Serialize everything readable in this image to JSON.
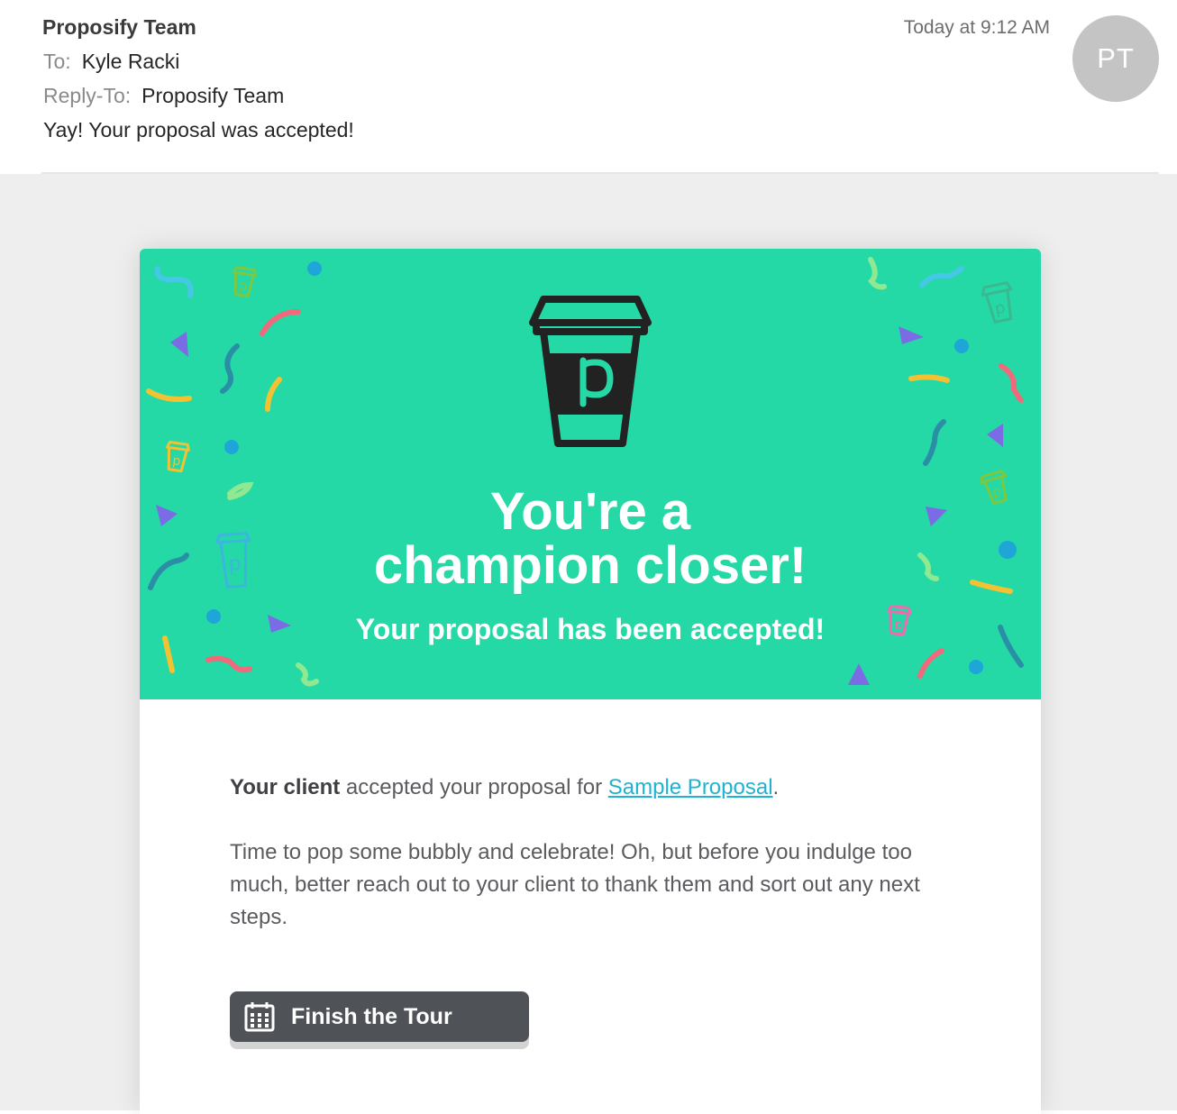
{
  "header": {
    "from": "Proposify Team",
    "to_label": "To:",
    "to_value": "Kyle Racki",
    "reply_to_label": "Reply-To:",
    "reply_to_value": "Proposify Team",
    "subject": "Yay! Your proposal was accepted!",
    "date": "Today at 9:12 AM",
    "avatar_initials": "PT"
  },
  "hero": {
    "headline_line1": "You're a",
    "headline_line2": "champion closer!",
    "subheadline": "Your proposal has been accepted!",
    "logo_letter": "p",
    "background_color": "#24d9a6"
  },
  "body": {
    "client_bold": "Your client",
    "accepted_text": " accepted your proposal for ",
    "proposal_link": "Sample Proposal",
    "period": ".",
    "paragraph2": "Time to pop some bubbly and celebrate! Oh, but before you indulge too much, better reach out to your client to thank them and sort out any next steps."
  },
  "cta": {
    "label": "Finish the Tour",
    "icon": "calendar-icon"
  }
}
